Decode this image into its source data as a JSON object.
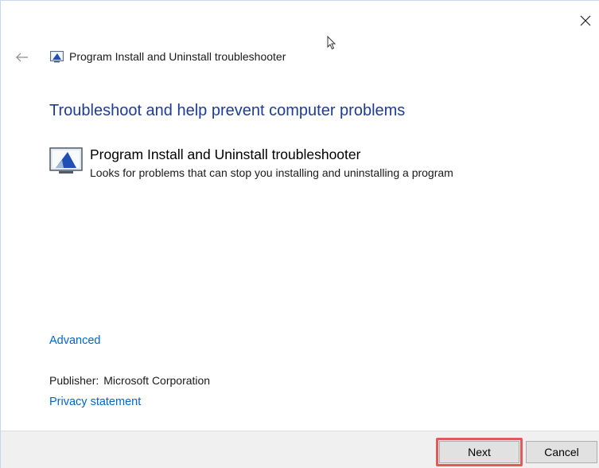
{
  "window": {
    "title": "Program Install and Uninstall troubleshooter"
  },
  "main": {
    "heading": "Troubleshoot and help prevent computer problems",
    "troubleshooter": {
      "title": "Program Install and Uninstall troubleshooter",
      "description": "Looks for problems that can stop you installing and uninstalling a program"
    },
    "advanced_link": "Advanced",
    "publisher_label": "Publisher:",
    "publisher_value": "Microsoft Corporation",
    "privacy_link": "Privacy statement"
  },
  "footer": {
    "next_label": "Next",
    "cancel_label": "Cancel"
  },
  "colors": {
    "heading": "#1e3c96",
    "link": "#0066cc",
    "highlight": "#e05a5a"
  }
}
